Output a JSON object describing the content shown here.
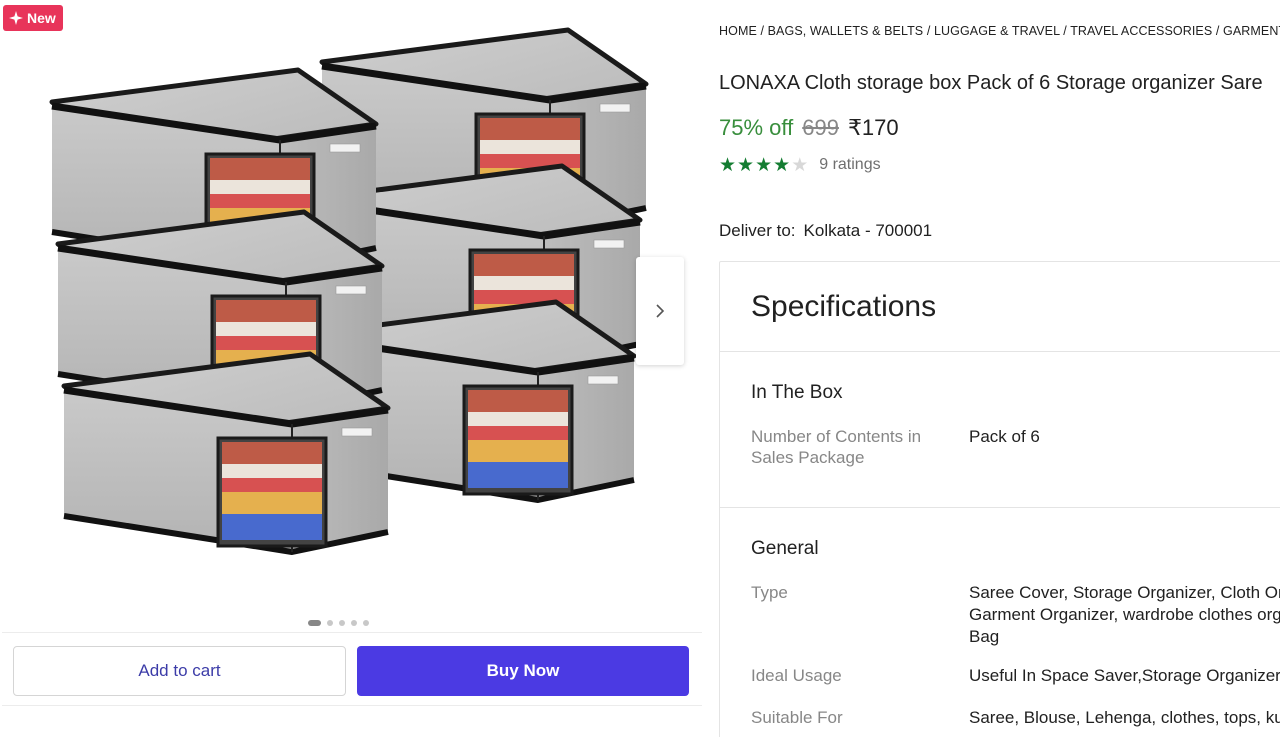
{
  "gallery": {
    "badge": "New",
    "image_alt": "Six grey storage boxes stacked in two columns",
    "dots_count": 5,
    "active_dot": 0
  },
  "actions": {
    "add_to_cart": "Add to cart",
    "buy_now": "Buy Now"
  },
  "breadcrumb": [
    "HOME",
    "BAGS, WALLETS & BELTS",
    "LUGGAGE & TRAVEL",
    "TRAVEL ACCESSORIES",
    "GARMENT CO"
  ],
  "product": {
    "title": "LONAXA Cloth storage box Pack of 6 Storage organizer Sare",
    "discount": "75% off",
    "mrp": "699",
    "price": "₹170",
    "rating_stars": 4,
    "ratings_text": "9 ratings"
  },
  "delivery": {
    "label": "Deliver to:",
    "location": "Kolkata - 700001"
  },
  "specs": {
    "title": "Specifications",
    "in_the_box": {
      "heading": "In The Box",
      "key": "Number of Contents in Sales Package",
      "value": "Pack of 6"
    },
    "general": {
      "heading": "General",
      "rows": [
        {
          "key": "Type",
          "value": "Saree Cover, Storage Organizer, Cloth Org\nGarment Organizer, wardrobe clothes org\nBag"
        },
        {
          "key": "Ideal Usage",
          "value": "Useful In Space Saver,Storage Organizer, S"
        },
        {
          "key": "Suitable For",
          "value": "Saree, Blouse, Lehenga, clothes, tops, kurt"
        }
      ]
    }
  },
  "colors": {
    "badge": "#e8345a",
    "buy_button": "#4b3ae3",
    "discount": "#388e3c",
    "star": "#147d32"
  }
}
